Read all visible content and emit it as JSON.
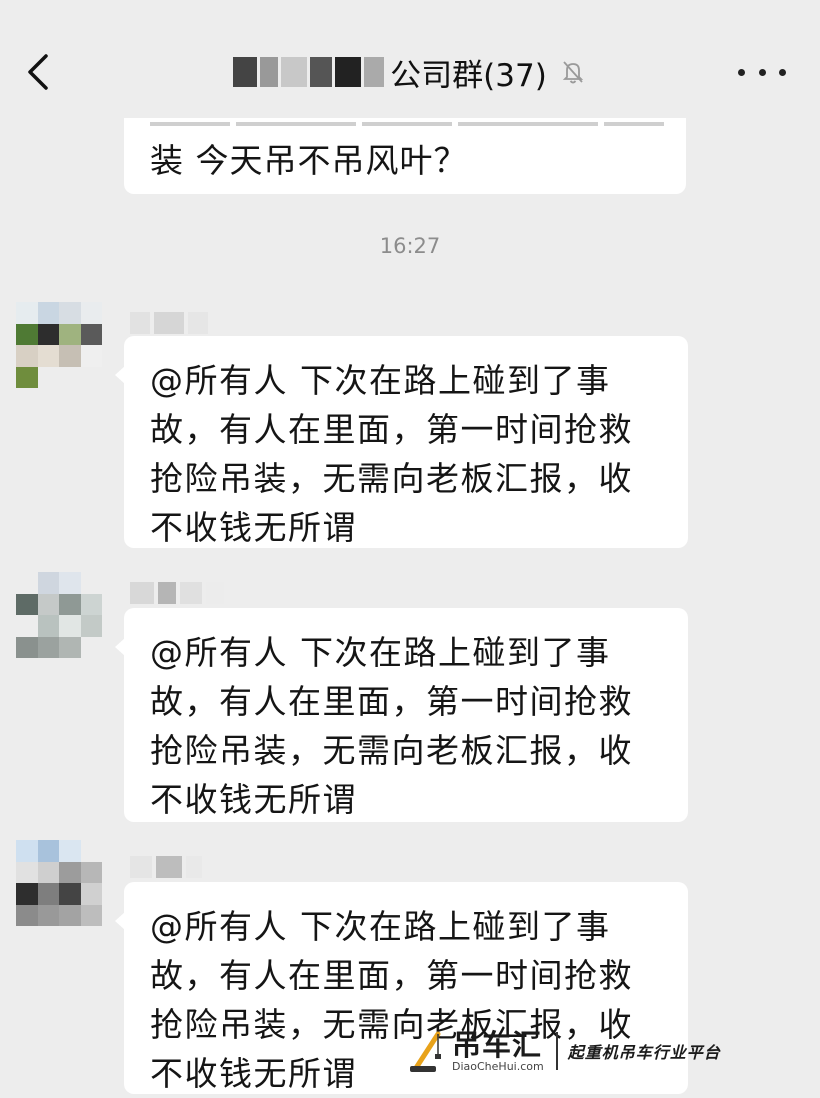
{
  "header": {
    "title": "公司群(37)"
  },
  "top_message": {
    "text": "装  今天吊不吊风叶？"
  },
  "timestamp": "16:27",
  "messages": [
    {
      "text": "@所有人  下次在路上碰到了事故，有人在里面，第一时间抢救抢险吊装，无需向老板汇报，收不收钱无所谓"
    },
    {
      "text": "@所有人  下次在路上碰到了事故，有人在里面，第一时间抢救抢险吊装，无需向老板汇报，收不收钱无所谓"
    },
    {
      "text": "@所有人  下次在路上碰到了事故，有人在里面，第一时间抢救抢险吊装，无需向老板汇报，收不收钱无所谓"
    }
  ],
  "watermark": {
    "name": "吊车汇",
    "url": "DiaoCheHui.com",
    "slogan": "起重机吊车行业平台"
  },
  "colors": {
    "background": "#ededed",
    "bubble": "#ffffff",
    "timestamp": "#8c8c8c",
    "watermark_accent": "#e8a21a"
  },
  "icons": {
    "back": "chevron-left-icon",
    "mute": "bell-off-icon",
    "more": "more-dots-icon",
    "logo": "crane-icon"
  }
}
